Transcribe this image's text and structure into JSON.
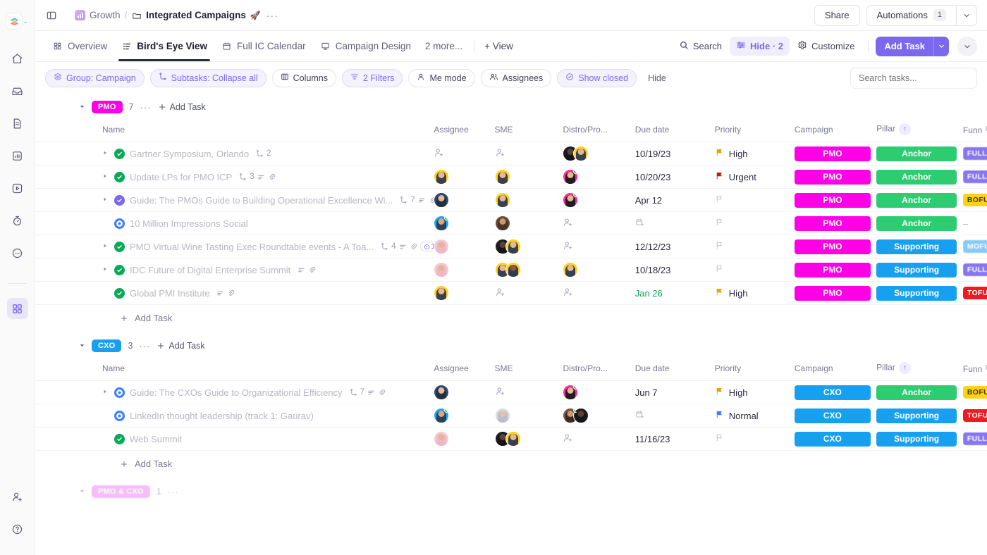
{
  "sidebar": {
    "logo_caret": "⌄",
    "items": [
      {
        "name": "home-icon",
        "label": "Home"
      },
      {
        "name": "inbox-icon",
        "label": "Inbox"
      },
      {
        "name": "docs-icon",
        "label": "Docs"
      },
      {
        "name": "dashboards-icon",
        "label": "Dashboards"
      },
      {
        "name": "clips-icon",
        "label": "Clips"
      },
      {
        "name": "timesheets-icon",
        "label": "Timesheets"
      },
      {
        "name": "more-icon",
        "label": "More"
      },
      {
        "name": "apps-grid-icon",
        "label": "Apps",
        "active": true
      }
    ],
    "bottom": [
      {
        "name": "invite-user-icon",
        "label": "Invite"
      },
      {
        "name": "help-icon",
        "label": "Help"
      }
    ]
  },
  "header": {
    "breadcrumb": {
      "space": "Growth",
      "separator": "/",
      "current": "Integrated Campaigns",
      "current_emoji": "🚀",
      "dots": "···"
    },
    "share_label": "Share",
    "automations_label": "Automations",
    "automations_count": "1",
    "caret": "⌄"
  },
  "tabs": {
    "items": [
      {
        "label": "Overview",
        "icon": "grid-icon",
        "active": false
      },
      {
        "label": "Bird's Eye View",
        "icon": "list-icon",
        "active": true
      },
      {
        "label": "Full IC Calendar",
        "icon": "calendar-icon",
        "active": false
      },
      {
        "label": "Campaign Design",
        "icon": "whiteboard-icon",
        "active": false
      }
    ],
    "more_label": "2 more...",
    "add_view_label": "+ View",
    "right": {
      "search_label": "Search",
      "hide_label": "Hide · 2",
      "customize_label": "Customize",
      "add_task_label": "Add Task",
      "caret": "⌄"
    }
  },
  "filterbar": {
    "chips": [
      {
        "label": "Group: Campaign",
        "icon": "layers-icon",
        "accent": true
      },
      {
        "label": "Subtasks: Collapse all",
        "icon": "subtask-icon",
        "accent": true
      },
      {
        "label": "Columns",
        "icon": "columns-icon",
        "accent": false
      },
      {
        "label": "2 Filters",
        "icon": "filter-icon",
        "accent": true
      },
      {
        "label": "Me mode",
        "icon": "person-icon",
        "accent": false
      },
      {
        "label": "Assignees",
        "icon": "people-icon",
        "accent": false
      },
      {
        "label": "Show closed",
        "icon": "check-circle-icon",
        "accent": true
      }
    ],
    "hide_label": "Hide",
    "search_placeholder": "Search tasks..."
  },
  "table": {
    "columns": [
      "Name",
      "Assignee",
      "SME",
      "Distro/Pro...",
      "Due date",
      "Priority",
      "Campaign",
      "Pillar",
      "Funn"
    ],
    "sort_indicator": "↑",
    "add_column": "+",
    "add_task_label": "Add Task"
  },
  "colors": {
    "accent": "#7b68ee",
    "pmo": "#ff00e6",
    "cxo": "#18a0f0",
    "anchor": "#2ecc71",
    "supporting": "#18a0f0",
    "full": "#7b68ee",
    "bofu": "#ffd11a",
    "mofu": "#7cc4f5",
    "tofu": "#ef1a24",
    "done": "#0aa958",
    "in_progress": "#3d7eff"
  },
  "groups": [
    {
      "name": "PMO",
      "color": "#ff00e6",
      "count": "7",
      "dots": "···",
      "add_task": "Add Task",
      "rows": [
        {
          "name": "Gartner Symposium, Orlando",
          "status": "done",
          "expandable": true,
          "meta": {
            "subtasks": "2",
            "has_description": false,
            "has_attachment": false,
            "comments": ""
          },
          "assignee": [],
          "sme": [],
          "distro": [
            "black",
            "gold"
          ],
          "due": "10/19/23",
          "due_green": false,
          "priority": "High",
          "priority_color": "#e8a400",
          "campaign": "PMO",
          "campaign_color": "#ff00e6",
          "pillar": "Anchor",
          "pillar_color": "#2ecc71",
          "funnel": "FULL",
          "funnel_color": "#7b68ee"
        },
        {
          "name": "Update LPs for PMO ICP",
          "status": "done",
          "expandable": true,
          "meta": {
            "subtasks": "3",
            "has_description": true,
            "has_attachment": true,
            "comments": ""
          },
          "assignee": [
            "gold"
          ],
          "sme": [
            "gold"
          ],
          "distro": [
            "pink-online"
          ],
          "due": "10/20/23",
          "due_green": false,
          "priority": "Urgent",
          "priority_color": "#b5231f",
          "campaign": "PMO",
          "campaign_color": "#ff00e6",
          "pillar": "Anchor",
          "pillar_color": "#2ecc71",
          "funnel": "FULL",
          "funnel_color": "#7b68ee"
        },
        {
          "name": "Guide: The PMOs Guide to Building Operational Excellence Wi...",
          "status": "purple",
          "expandable": true,
          "meta": {
            "subtasks": "7",
            "has_description": true,
            "has_attachment": true,
            "comments": ""
          },
          "assignee": [
            "navy"
          ],
          "sme": [
            "gold"
          ],
          "distro": [
            "pink-online"
          ],
          "due": "Apr 12",
          "due_green": false,
          "priority": "",
          "priority_color": "",
          "campaign": "PMO",
          "campaign_color": "#ff00e6",
          "pillar": "Anchor",
          "pillar_color": "#2ecc71",
          "funnel": "BOFU",
          "funnel_color": "#ffd11a"
        },
        {
          "name": "10 Million Impressions Social",
          "status": "prog",
          "expandable": false,
          "meta": {
            "subtasks": "",
            "has_description": false,
            "has_attachment": false,
            "comments": ""
          },
          "assignee": [
            "blue-online"
          ],
          "sme": [
            "brown"
          ],
          "distro": [],
          "due": "",
          "due_green": false,
          "priority": "",
          "priority_color": "",
          "campaign": "PMO",
          "campaign_color": "#ff00e6",
          "pillar": "Anchor",
          "pillar_color": "#2ecc71",
          "funnel": "",
          "funnel_color": ""
        },
        {
          "name": "PMO Virtual Wine Tasting Exec Roundtable events - A Toa...",
          "status": "done",
          "expandable": true,
          "meta": {
            "subtasks": "4",
            "has_description": true,
            "has_attachment": true,
            "comments": "1"
          },
          "assignee": [
            "pink"
          ],
          "sme": [
            "black",
            "gold"
          ],
          "distro": [],
          "due": "12/12/23",
          "due_green": false,
          "priority": "",
          "priority_color": "",
          "campaign": "PMO",
          "campaign_color": "#ff00e6",
          "pillar": "Supporting",
          "pillar_color": "#18a0f0",
          "funnel": "MOFU",
          "funnel_color": "#7cc4f5"
        },
        {
          "name": "IDC Future of Digital Enterprise Summit",
          "status": "done",
          "expandable": true,
          "meta": {
            "subtasks": "",
            "has_description": true,
            "has_attachment": true,
            "comments": ""
          },
          "assignee": [
            "pink"
          ],
          "sme": [
            "gold",
            "gold2"
          ],
          "distro": [
            "gold"
          ],
          "due": "10/18/23",
          "due_green": false,
          "priority": "",
          "priority_color": "",
          "campaign": "PMO",
          "campaign_color": "#ff00e6",
          "pillar": "Supporting",
          "pillar_color": "#18a0f0",
          "funnel": "FULL",
          "funnel_color": "#7b68ee"
        },
        {
          "name": "Global PMI Institute",
          "status": "done",
          "expandable": false,
          "meta": {
            "subtasks": "",
            "has_description": true,
            "has_attachment": true,
            "comments": ""
          },
          "assignee": [
            "gold"
          ],
          "sme": [],
          "distro": [],
          "due": "Jan 26",
          "due_green": true,
          "priority": "High",
          "priority_color": "#e8a400",
          "campaign": "PMO",
          "campaign_color": "#ff00e6",
          "pillar": "Supporting",
          "pillar_color": "#18a0f0",
          "funnel": "TOFU",
          "funnel_color": "#ef1a24"
        }
      ]
    },
    {
      "name": "CXO",
      "color": "#18a0f0",
      "count": "3",
      "dots": "···",
      "add_task": "Add Task",
      "rows": [
        {
          "name": "Guide: The CXOs Guide to Organizational Efficiency",
          "status": "prog",
          "expandable": true,
          "meta": {
            "subtasks": "7",
            "has_description": true,
            "has_attachment": true,
            "comments": ""
          },
          "assignee": [
            "navy"
          ],
          "sme": [],
          "distro": [
            "pink-online"
          ],
          "due": "Jun 7",
          "due_green": false,
          "priority": "High",
          "priority_color": "#e8a400",
          "campaign": "CXO",
          "campaign_color": "#18a0f0",
          "pillar": "Anchor",
          "pillar_color": "#2ecc71",
          "funnel": "BOFU",
          "funnel_color": "#ffd11a"
        },
        {
          "name": "LinkedIn thought leadership (track 1: Gaurav)",
          "status": "prog",
          "expandable": false,
          "meta": {
            "subtasks": "",
            "has_description": false,
            "has_attachment": false,
            "comments": ""
          },
          "assignee": [
            "blue-online"
          ],
          "sme": [
            "lightgray"
          ],
          "distro": [
            "brown-online",
            "black"
          ],
          "due": "",
          "due_green": false,
          "priority": "Normal",
          "priority_color": "#3d7eff",
          "campaign": "CXO",
          "campaign_color": "#18a0f0",
          "pillar": "Supporting",
          "pillar_color": "#18a0f0",
          "funnel": "TOFU",
          "funnel_color": "#ef1a24"
        },
        {
          "name": "Web Summit",
          "status": "done",
          "expandable": false,
          "meta": {
            "subtasks": "",
            "has_description": false,
            "has_attachment": false,
            "comments": ""
          },
          "assignee": [
            "pink"
          ],
          "sme": [
            "black",
            "gold"
          ],
          "distro": [],
          "due": "11/16/23",
          "due_green": false,
          "priority": "",
          "priority_color": "",
          "campaign": "CXO",
          "campaign_color": "#18a0f0",
          "pillar": "Supporting",
          "pillar_color": "#18a0f0",
          "funnel": "FULL",
          "funnel_color": "#7b68ee"
        }
      ]
    },
    {
      "name": "PMO & CXO",
      "color": "#ea6ef5",
      "count": "1",
      "dots": "···",
      "add_task": "Add Task",
      "rows": []
    }
  ]
}
